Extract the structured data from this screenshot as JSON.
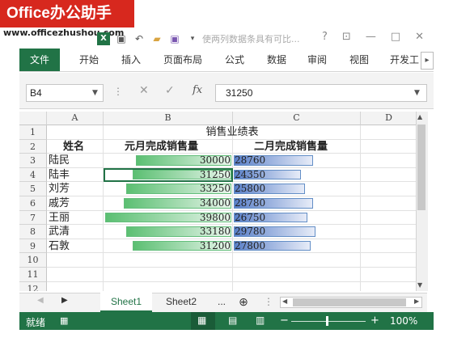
{
  "watermark": {
    "brand": "Office办公助手",
    "url": "www.officezhushou.com"
  },
  "window": {
    "title": "使两列数据条具有可比...",
    "help": "?",
    "ribbon_display": "⊡",
    "minimize": "—",
    "maximize": "□",
    "close": "✕"
  },
  "ribbon": {
    "tabs": [
      "文件",
      "开始",
      "插入",
      "页面布局",
      "公式",
      "数据",
      "审阅",
      "视图",
      "开发工"
    ],
    "scroll": "▸"
  },
  "formula_bar": {
    "name_box": "B4",
    "cancel": "✕",
    "enter": "✓",
    "fx": "fx",
    "value": "31250"
  },
  "sheet": {
    "columns": [
      "A",
      "B",
      "C",
      "D"
    ],
    "rows": [
      "1",
      "2",
      "3",
      "4",
      "5",
      "6",
      "7",
      "8",
      "9",
      "10",
      "11",
      "12"
    ],
    "title": "销售业绩表",
    "headers": [
      "姓名",
      "元月完成销售量",
      "二月完成销售量"
    ],
    "records": [
      {
        "name": "陆民",
        "jan": 30000,
        "feb": 28760
      },
      {
        "name": "陆丰",
        "jan": 31250,
        "feb": 24350
      },
      {
        "name": "刘芳",
        "jan": 33250,
        "feb": 25800
      },
      {
        "name": "戚芳",
        "jan": 34000,
        "feb": 28780
      },
      {
        "name": "王丽",
        "jan": 39800,
        "feb": 26750
      },
      {
        "name": "武清",
        "jan": 33180,
        "feb": 29780
      },
      {
        "name": "石敦",
        "jan": 31200,
        "feb": 27800
      }
    ],
    "databar_colors": {
      "jan": "#63be7b",
      "feb": "#638ec6"
    }
  },
  "sheet_tabs": {
    "tabs": [
      "Sheet1",
      "Sheet2"
    ],
    "active": "Sheet1",
    "more": "...",
    "add": "⊕"
  },
  "status": {
    "ready": "就绪",
    "zoom": "100%",
    "zoom_minus": "−",
    "zoom_plus": "+"
  }
}
